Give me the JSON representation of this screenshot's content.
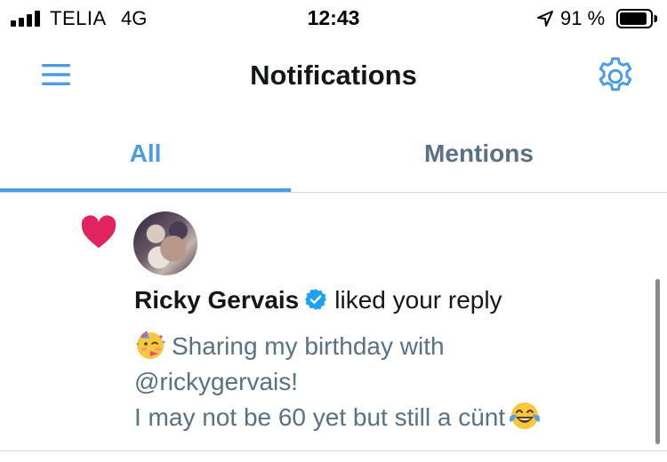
{
  "status_bar": {
    "carrier": "TELIA",
    "network": "4G",
    "time": "12:43",
    "battery_percent": "91 %",
    "battery_level": 0.91
  },
  "header": {
    "title": "Notifications",
    "menu_icon": "hamburger-menu-icon",
    "settings_icon": "gear-icon"
  },
  "tabs": [
    {
      "label": "All",
      "selected": true
    },
    {
      "label": "Mentions",
      "selected": false
    }
  ],
  "notification": {
    "type_icon": "heart-icon",
    "user_name": "Ricky Gervais",
    "verified": true,
    "action": "liked your reply",
    "tweet_lines": [
      "Sharing my birthday with",
      "@rickygervais!",
      "I may not be 60 yet but still a cünt"
    ],
    "leading_emoji": "party-face-icon",
    "trailing_emoji": "tears-of-joy-icon"
  },
  "colors": {
    "accent": "#4d9be0",
    "heart": "#e0245e",
    "muted_text": "#5b7083",
    "verified": "#1da1f2"
  }
}
